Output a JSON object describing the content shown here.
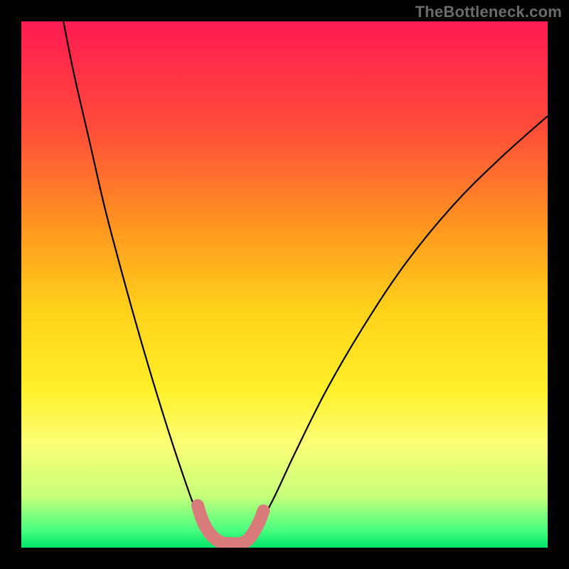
{
  "watermark": {
    "text": "TheBottleneck.com"
  },
  "chart_data": {
    "type": "line",
    "title": "",
    "xlabel": "",
    "ylabel": "",
    "xlim": [
      0,
      100
    ],
    "ylim": [
      0,
      100
    ],
    "background_gradient": {
      "stops": [
        {
          "offset": 0.0,
          "color": "#ff1a52"
        },
        {
          "offset": 0.2,
          "color": "#ff4b3a"
        },
        {
          "offset": 0.4,
          "color": "#ff9a1f"
        },
        {
          "offset": 0.55,
          "color": "#ffd21a"
        },
        {
          "offset": 0.7,
          "color": "#fff029"
        },
        {
          "offset": 0.8,
          "color": "#fdff75"
        },
        {
          "offset": 0.9,
          "color": "#c9ff7a"
        },
        {
          "offset": 0.965,
          "color": "#4dff80"
        },
        {
          "offset": 1.0,
          "color": "#00e66b"
        }
      ]
    },
    "series": [
      {
        "name": "bottleneck-curve",
        "color": "#000000",
        "type": "line",
        "points": [
          {
            "x": 8.0,
            "y": 100.0
          },
          {
            "x": 10.0,
            "y": 90.0
          },
          {
            "x": 13.0,
            "y": 77.0
          },
          {
            "x": 16.0,
            "y": 64.0
          },
          {
            "x": 20.0,
            "y": 49.0
          },
          {
            "x": 24.0,
            "y": 35.0
          },
          {
            "x": 28.0,
            "y": 22.0
          },
          {
            "x": 31.0,
            "y": 13.0
          },
          {
            "x": 33.0,
            "y": 7.5
          },
          {
            "x": 35.0,
            "y": 3.5
          },
          {
            "x": 37.0,
            "y": 1.2
          },
          {
            "x": 39.0,
            "y": 0.5
          },
          {
            "x": 41.0,
            "y": 0.5
          },
          {
            "x": 43.0,
            "y": 1.5
          },
          {
            "x": 45.0,
            "y": 4.0
          },
          {
            "x": 48.0,
            "y": 9.5
          },
          {
            "x": 52.0,
            "y": 18.0
          },
          {
            "x": 58.0,
            "y": 30.0
          },
          {
            "x": 65.0,
            "y": 42.0
          },
          {
            "x": 73.0,
            "y": 54.0
          },
          {
            "x": 82.0,
            "y": 65.0
          },
          {
            "x": 91.0,
            "y": 74.0
          },
          {
            "x": 100.0,
            "y": 82.0
          }
        ]
      },
      {
        "name": "highlight-band",
        "color": "#d97b7b",
        "type": "line",
        "points": [
          {
            "x": 33.5,
            "y": 8.0
          },
          {
            "x": 34.5,
            "y": 5.0
          },
          {
            "x": 36.0,
            "y": 2.5
          },
          {
            "x": 38.0,
            "y": 1.0
          },
          {
            "x": 40.0,
            "y": 0.8
          },
          {
            "x": 42.0,
            "y": 0.9
          },
          {
            "x": 43.5,
            "y": 2.0
          },
          {
            "x": 45.0,
            "y": 4.5
          },
          {
            "x": 46.0,
            "y": 7.0
          }
        ]
      }
    ]
  }
}
